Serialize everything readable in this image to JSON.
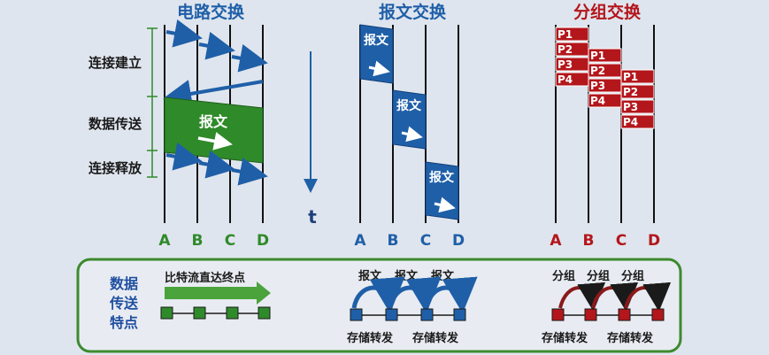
{
  "titles": {
    "circuit": "电路交换",
    "message": "报文交换",
    "packet": "分组交换"
  },
  "phases": [
    "连接建立",
    "数据传送",
    "连接释放"
  ],
  "nodes": [
    "A",
    "B",
    "C",
    "D"
  ],
  "time_label": "t",
  "message_label": "报文",
  "packets": [
    "P1",
    "P2",
    "P3",
    "P4"
  ],
  "bottom": {
    "title": [
      "数据",
      "传送",
      "特点"
    ],
    "bitstream": "比特流直达终点",
    "message_hop": "报文",
    "packet_hop": "分组",
    "store_forward": "存储转发"
  },
  "colors": {
    "blue": "#1f5fa8",
    "green": "#2f8a2a",
    "red": "#b3161b",
    "line": "#111111"
  }
}
